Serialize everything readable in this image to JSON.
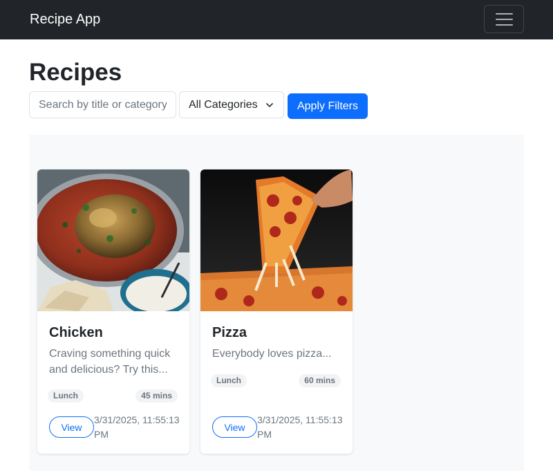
{
  "navbar": {
    "brand": "Recipe App",
    "menu_icon": "hamburger-menu-icon"
  },
  "page": {
    "title": "Recipes"
  },
  "filters": {
    "search_placeholder": "Search by title or category",
    "search_value": "",
    "category_selected": "All Categories",
    "apply_label": "Apply Filters"
  },
  "recipes": [
    {
      "title": "Chicken",
      "description": "Craving something quick and delicious? Try this...",
      "category": "Lunch",
      "time": "45 mins",
      "view_label": "View",
      "timestamp": "3/31/2025, 11:55:13 PM",
      "image": "roast-chicken-in-curry-photo"
    },
    {
      "title": "Pizza",
      "description": "Everybody loves pizza...",
      "category": "Lunch",
      "time": "60 mins",
      "view_label": "View",
      "timestamp": "3/31/2025, 11:55:13 PM",
      "image": "pepperoni-pizza-slice-photo"
    }
  ],
  "colors": {
    "navbar_bg": "#212529",
    "primary": "#0d6efd",
    "muted_text": "#6c757d",
    "panel_bg": "#f8f9fa"
  }
}
